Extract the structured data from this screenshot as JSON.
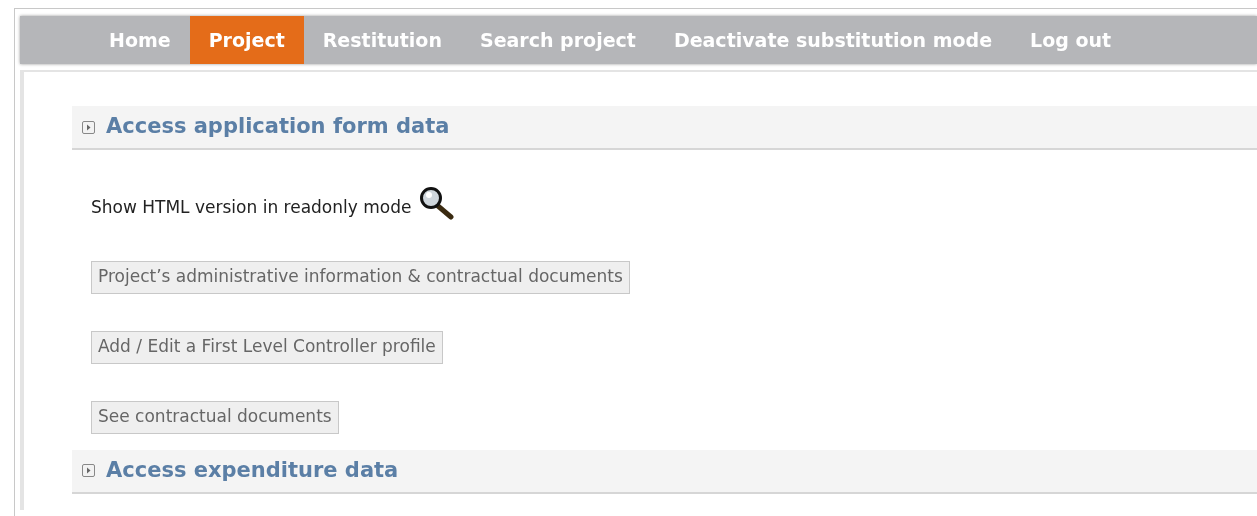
{
  "nav": [
    {
      "label": "Home",
      "selected": false
    },
    {
      "label": "Project",
      "selected": true
    },
    {
      "label": "Restitution",
      "selected": false
    },
    {
      "label": "Search project",
      "selected": false
    },
    {
      "label": "Deactivate substitution mode",
      "selected": false
    },
    {
      "label": "Log out",
      "selected": false
    }
  ],
  "sections": [
    {
      "title": "Access application form data",
      "link": "Show HTML version in readonly mode",
      "buttons": [
        "Project’s administrative information & contractual documents",
        "Add / Edit a First Level Controller profile",
        "See contractual documents"
      ]
    },
    {
      "title": "Access expenditure data"
    }
  ]
}
